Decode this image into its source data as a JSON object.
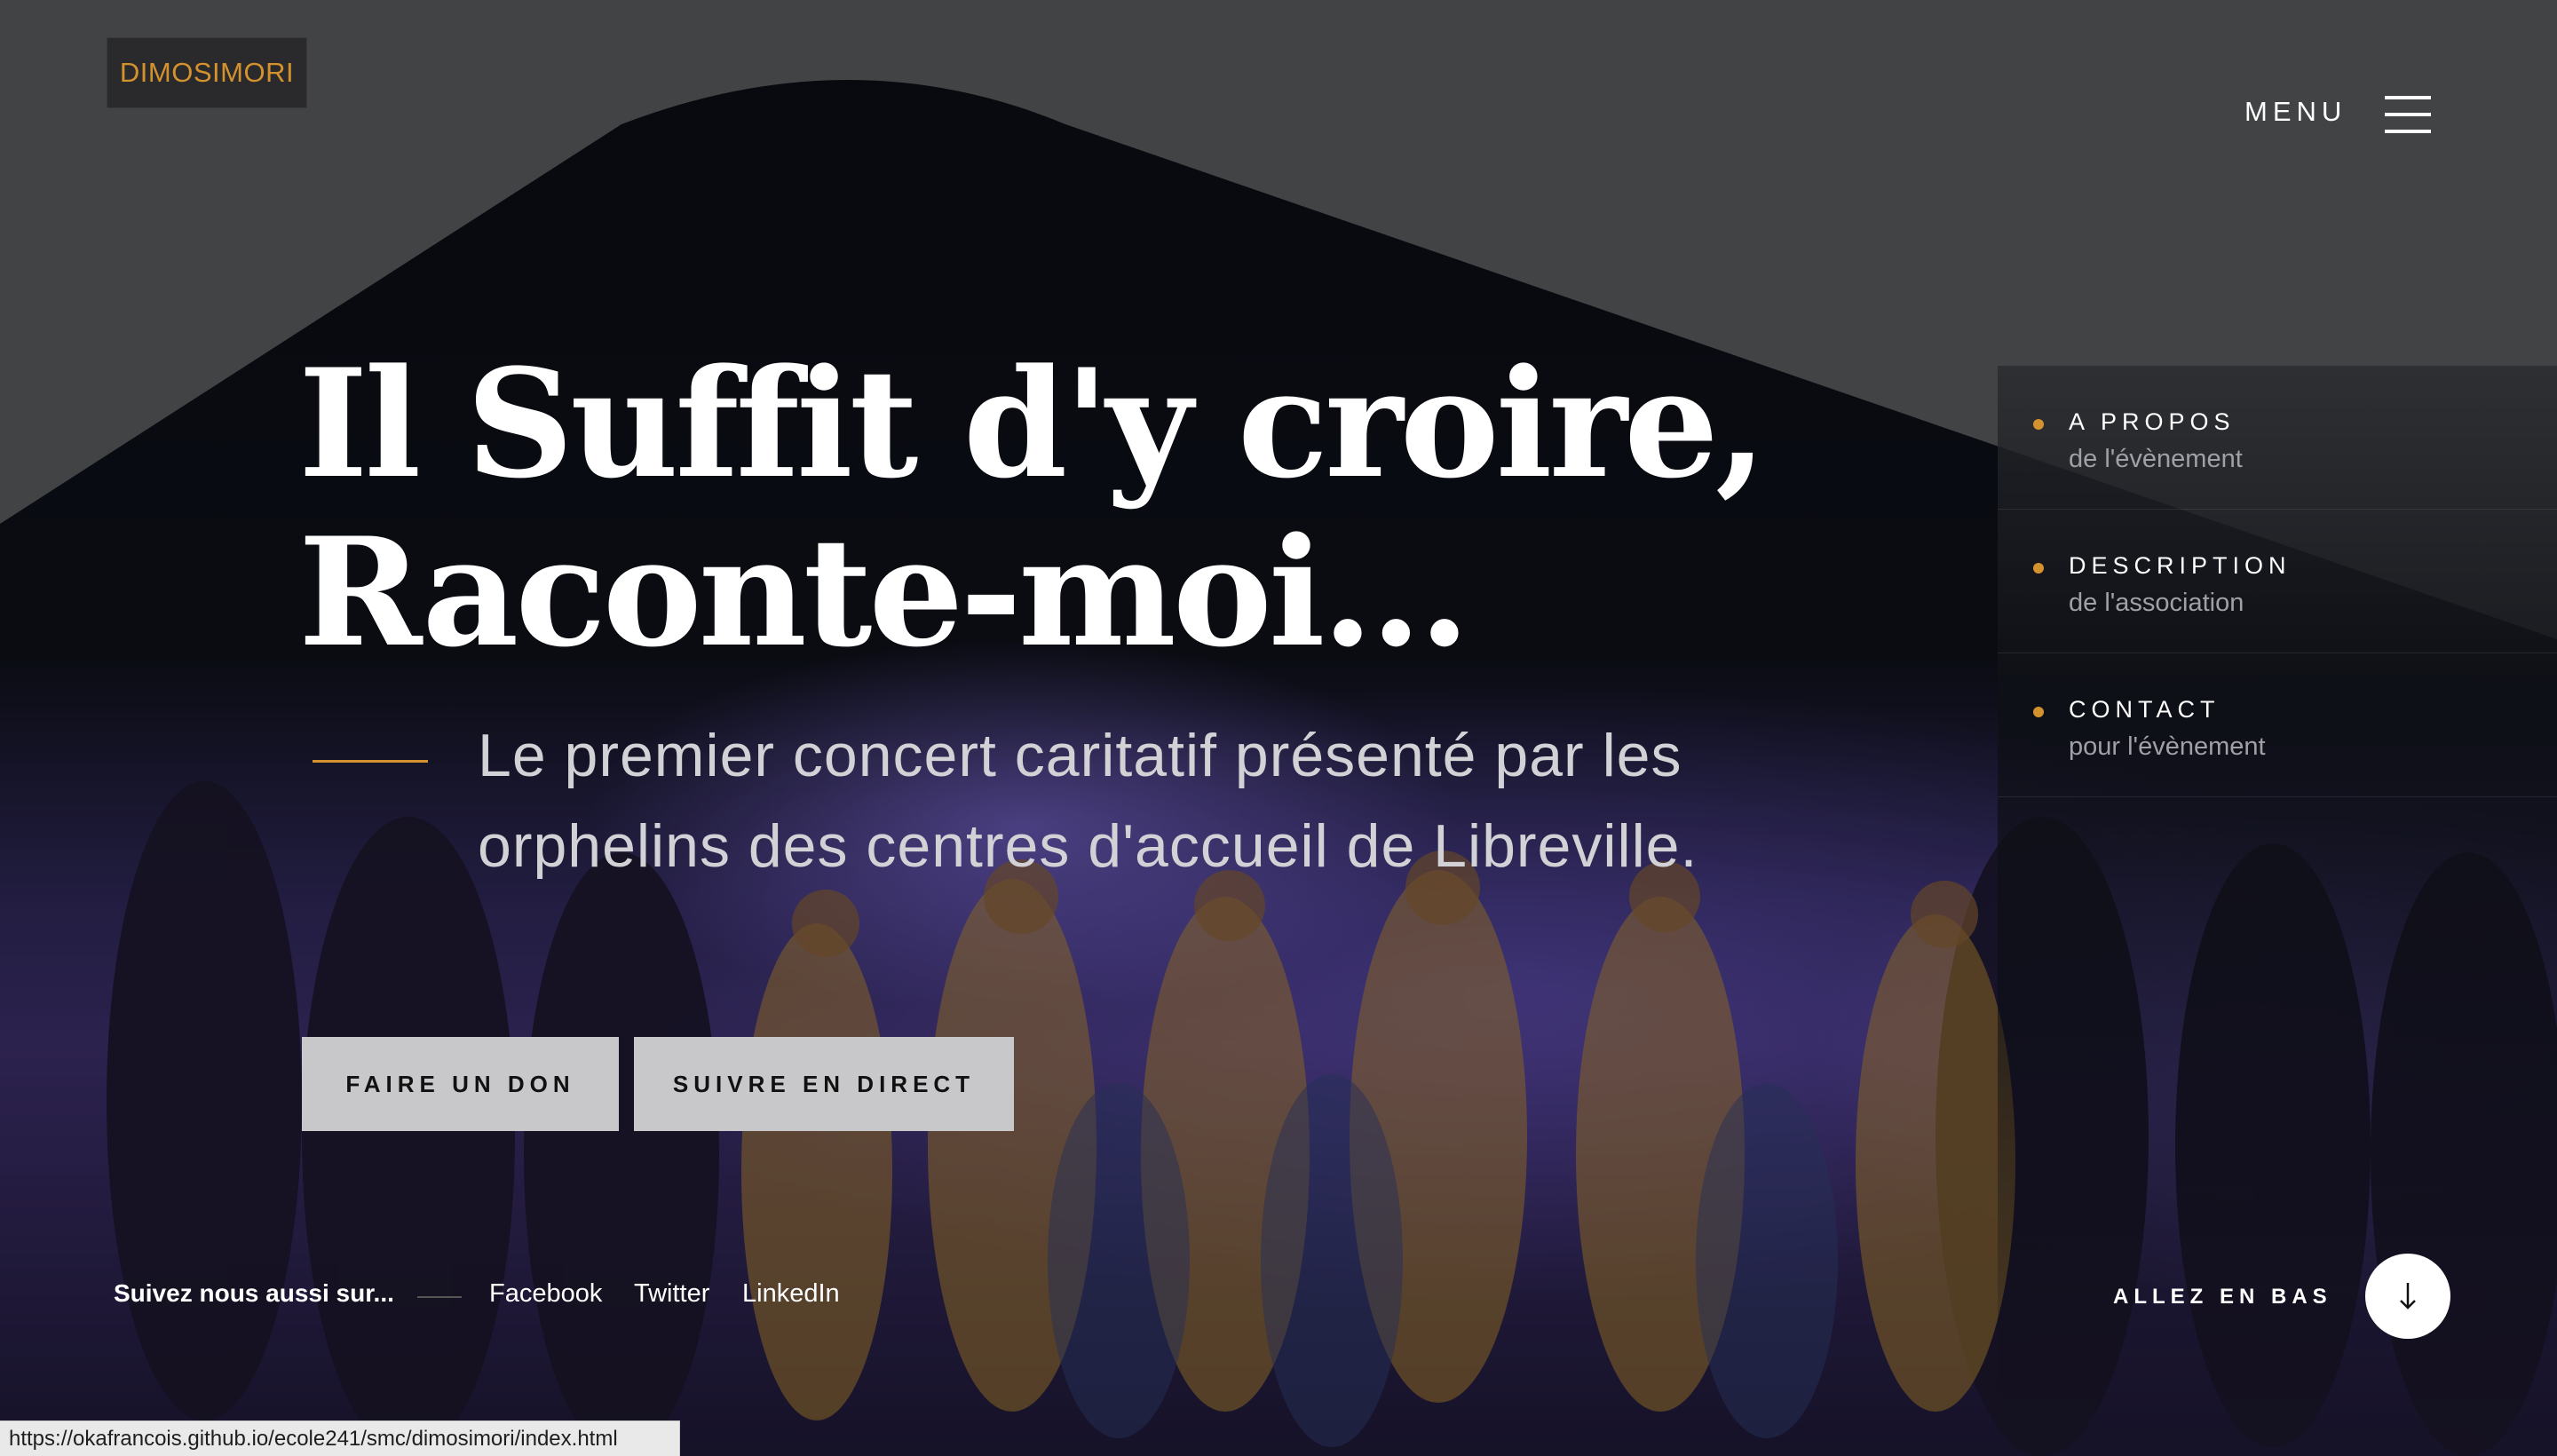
{
  "brand": {
    "logo_text": "DIMOSIMORI"
  },
  "header": {
    "menu_label": "MENU"
  },
  "hero": {
    "headline_line1": "Il Suffit d'y croire,",
    "headline_line2": "Raconte-moi...",
    "subtitle": "Le premier concert caritatif présenté par les orphelins des centres d'accueil de Libreville."
  },
  "buttons": {
    "donate": "FAIRE UN DON",
    "live": "SUIVRE EN DIRECT"
  },
  "side_nav": {
    "items": [
      {
        "title": "A PROPOS",
        "subtitle": "de l'évènement"
      },
      {
        "title": "DESCRIPTION",
        "subtitle": "de l'association"
      },
      {
        "title": "CONTACT",
        "subtitle": "pour l'évènement"
      }
    ]
  },
  "social": {
    "label": "Suivez nous aussi sur...",
    "links": [
      "Facebook",
      "Twitter",
      "LinkedIn"
    ]
  },
  "scroll": {
    "label": "ALLEZ EN BAS"
  },
  "status_bar": {
    "url": "https://okafrancois.github.io/ecole241/smc/dimosimori/index.html"
  },
  "colors": {
    "accent": "#d4922e",
    "button_bg": "#c8c8ca",
    "logo_bg": "#2a2a2c"
  }
}
